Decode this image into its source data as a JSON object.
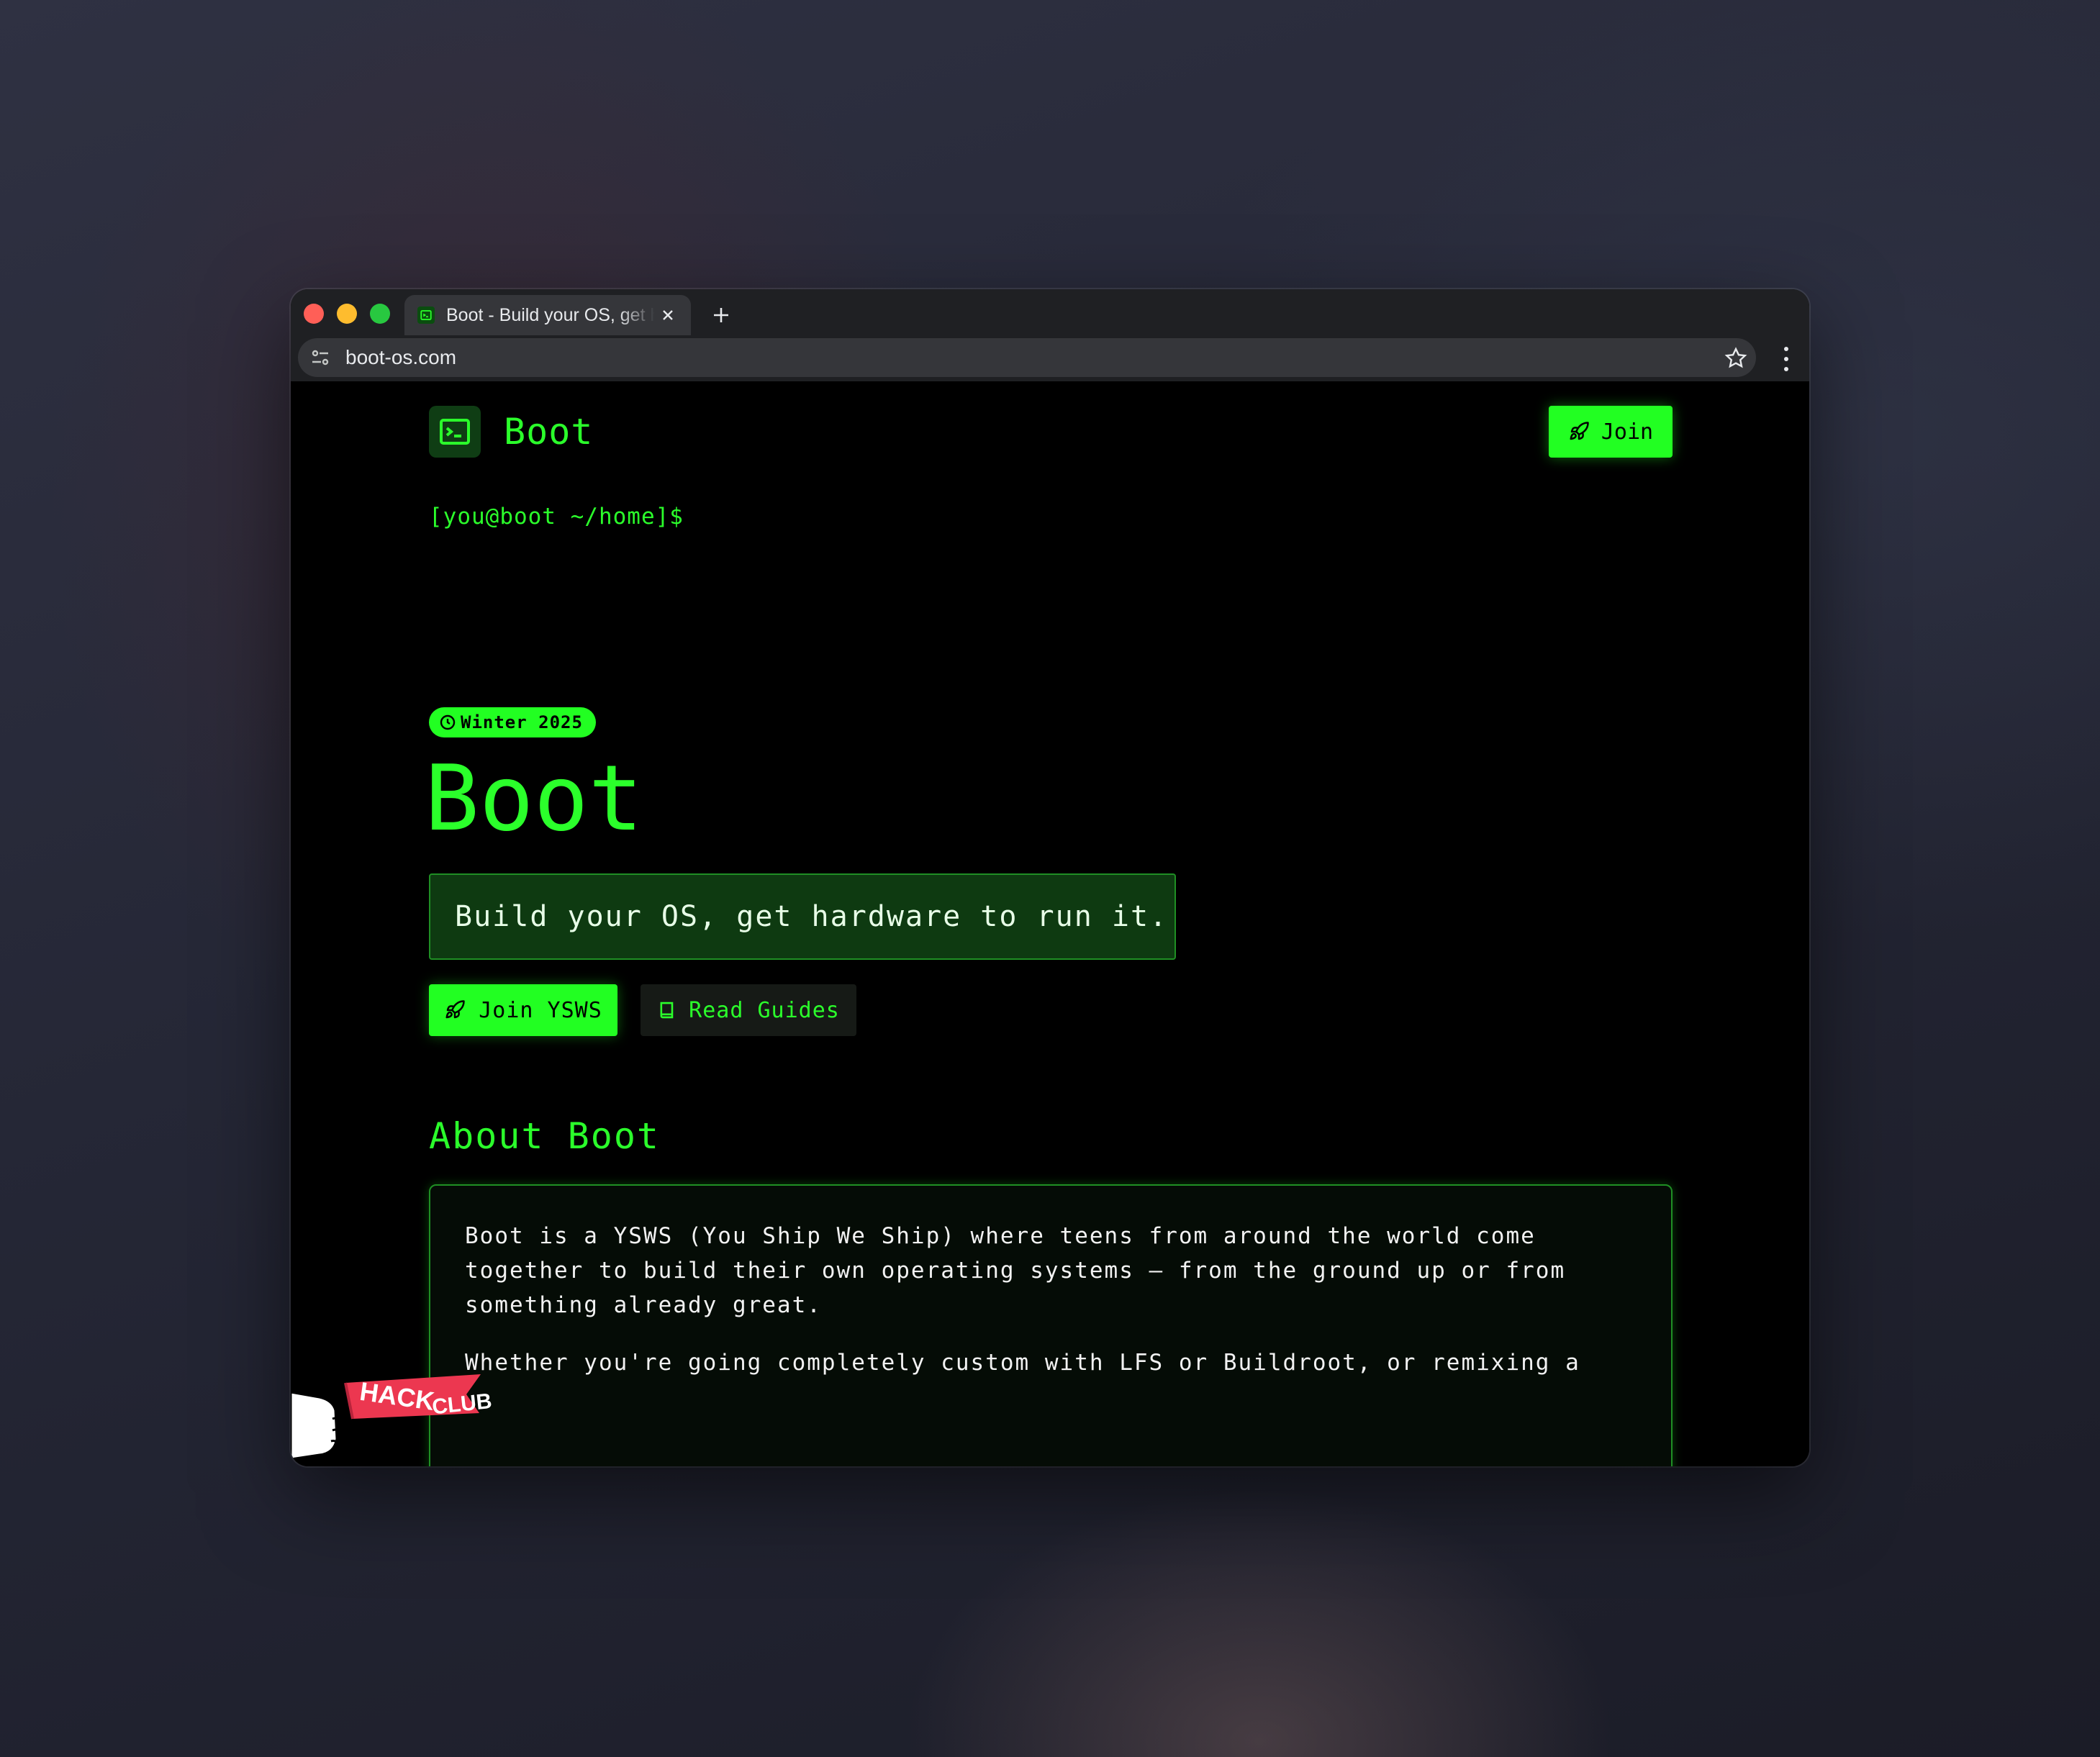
{
  "browser": {
    "tab_title": "Boot - Build your OS, get hardware to run it",
    "url": "boot-os.com",
    "colors": {
      "close": "#ff5f57",
      "minimize": "#febc2e",
      "maximize": "#28c840"
    }
  },
  "header": {
    "brand": "Boot",
    "join_label": "Join"
  },
  "prompt": "[you@boot ~/home]$",
  "hero": {
    "badge": "Winter 2025",
    "title": "Boot",
    "tagline": "Build your OS, get hardware to run it.",
    "primary_button": "Join YSWS",
    "secondary_button": "Read Guides"
  },
  "about": {
    "title": "About Boot",
    "paragraph1": "Boot is a YSWS (You Ship We Ship) where teens from around the world come together to build their own operating systems — from the ground up or from something already great.",
    "paragraph2": "Whether you're going completely custom with LFS or Buildroot, or remixing a"
  },
  "flag": {
    "text": "HACK CLUB"
  },
  "theme": {
    "accent": "#22ff22",
    "background": "#000000"
  }
}
